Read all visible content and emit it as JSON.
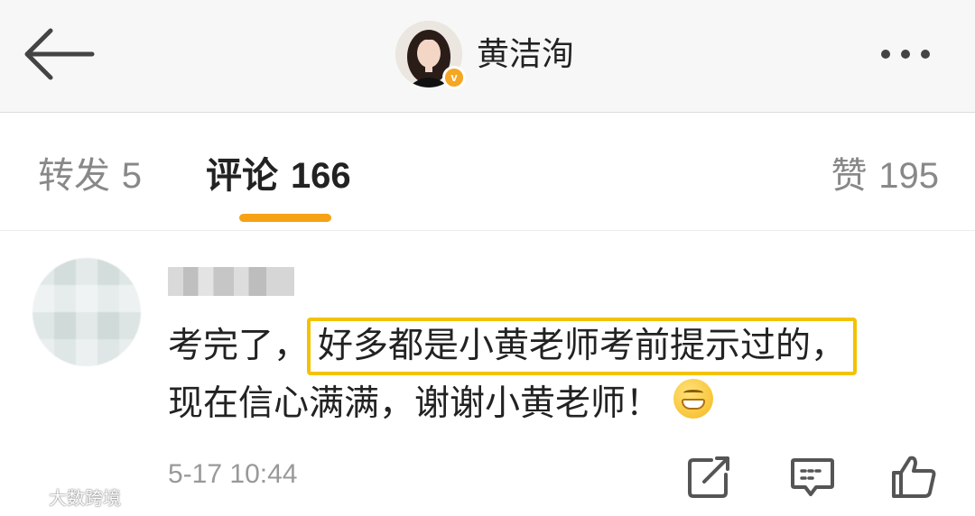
{
  "header": {
    "back_icon": "arrow-left-icon",
    "title": "黄洁洵",
    "verified_badge": "v",
    "more_icon": "more-dots-icon",
    "accent_color": "#f6a215"
  },
  "tabs": {
    "repost": {
      "label": "转发",
      "count": "5"
    },
    "comments": {
      "label": "评论",
      "count": "166"
    },
    "likes": {
      "label": "赞",
      "count": "195"
    },
    "active": "comments"
  },
  "comment": {
    "username": "",
    "text_line1_prefix": "考完了，",
    "text_line1_highlight": "好多都是小黄老师考前提示过的",
    "text_line1_suffix": "，",
    "text_line2": "现在信心满满，谢谢小黄老师！",
    "emoji": "grinning-face",
    "timestamp": "5-17 10:44",
    "actions": [
      "share-icon",
      "comment-icon",
      "thumbs-up-icon"
    ]
  },
  "watermark": {
    "text": "大数跨境"
  }
}
